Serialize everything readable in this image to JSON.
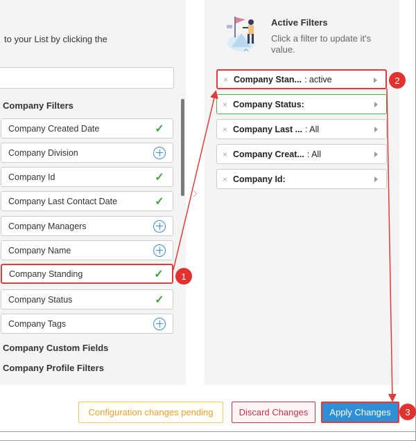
{
  "left": {
    "intro_text": "to your List by clicking the",
    "section_company_filters": "Company Filters",
    "filters": [
      {
        "label": "Company Created Date",
        "status": "check"
      },
      {
        "label": "Company Division",
        "status": "plus"
      },
      {
        "label": "Company Id",
        "status": "check"
      },
      {
        "label": "Company Last Contact Date",
        "status": "check"
      },
      {
        "label": "Company Managers",
        "status": "plus"
      },
      {
        "label": "Company Name",
        "status": "plus"
      },
      {
        "label": "Company Standing",
        "status": "check"
      },
      {
        "label": "Company Status",
        "status": "check"
      },
      {
        "label": "Company Tags",
        "status": "plus"
      }
    ],
    "section_custom_fields": "Company Custom Fields",
    "section_profile_filters": "Company Profile Filters",
    "check_glyph": "✓"
  },
  "right": {
    "title": "Active Filters",
    "description": "Click a filter to update it's value.",
    "remove_glyph": "×",
    "chips": [
      {
        "name": "Company Stan...",
        "value": ": active"
      },
      {
        "name": "Company Status:",
        "value": ""
      },
      {
        "name": "Company Last ...",
        "value": ": All"
      },
      {
        "name": "Company Creat...",
        "value": ": All"
      },
      {
        "name": "Company Id:",
        "value": ""
      }
    ]
  },
  "footer": {
    "pending_label": "Configuration changes pending",
    "discard_label": "Discard Changes",
    "apply_label": "Apply Changes"
  },
  "annotations": {
    "badge_1": "1",
    "badge_2": "2",
    "badge_3": "3"
  },
  "colors": {
    "accent_blue": "#2f8fd4",
    "annotation_red": "#e03a3a",
    "check_green": "#3fa33a",
    "pending_orange": "#e8a23a",
    "discard_red": "#c2334f"
  }
}
